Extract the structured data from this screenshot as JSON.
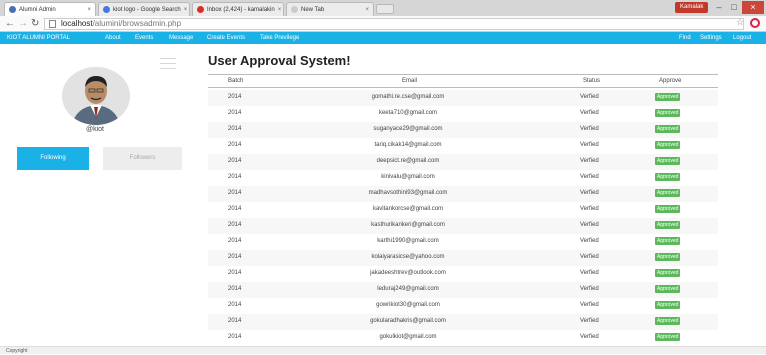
{
  "browser": {
    "tabs": [
      {
        "title": "Alumni Admin",
        "fav": "#4a6fb5"
      },
      {
        "title": "kiot logo - Google Search",
        "fav": "#3d7be0"
      },
      {
        "title": "Inbox (2,424) - kamalakin",
        "fav": "#d93025"
      },
      {
        "title": "New Tab",
        "fav": "#cccccc"
      }
    ],
    "user_badge": "Kamalak",
    "url_host": "localhost",
    "url_path": "/alumini/browsadmin.php"
  },
  "nav": {
    "brand": "KIOT ALUMNI PORTAL",
    "links": [
      "About",
      "Events",
      "Message",
      "Create Events",
      "Take Previlege"
    ],
    "right": [
      "Find",
      "Settings",
      "Logout"
    ]
  },
  "sidebar": {
    "username": "@kiot",
    "following_label": "Following",
    "followers_label": "Followers"
  },
  "main": {
    "title": "User Approval System!",
    "headers": {
      "batch": "Batch",
      "email": "Email",
      "status": "Status",
      "approve": "Approve"
    },
    "rows": [
      {
        "batch": "2014",
        "email": "gomathi.re.cse@gmail.com",
        "status": "Verfied",
        "approve": "Approved"
      },
      {
        "batch": "2014",
        "email": "keeta710@gmail.com",
        "status": "Verfied",
        "approve": "Approved"
      },
      {
        "batch": "2014",
        "email": "suganyace29@gmail.com",
        "status": "Verfied",
        "approve": "Approved"
      },
      {
        "batch": "2014",
        "email": "tariq.cikak14@gmail.com",
        "status": "Verfied",
        "approve": "Approved"
      },
      {
        "batch": "2014",
        "email": "deepsict.re@gmail.com",
        "status": "Verfied",
        "approve": "Approved"
      },
      {
        "batch": "2014",
        "email": "kinivalu@gmail.com",
        "status": "Verfied",
        "approve": "Approved"
      },
      {
        "batch": "2014",
        "email": "madhavsothini93@gmail.com",
        "status": "Verfied",
        "approve": "Approved"
      },
      {
        "batch": "2014",
        "email": "kavitankorcse@gmail.com",
        "status": "Verfied",
        "approve": "Approved"
      },
      {
        "batch": "2014",
        "email": "kasthurikankeri@gmail.com",
        "status": "Verfied",
        "approve": "Approved"
      },
      {
        "batch": "2014",
        "email": "karthi1990@gmail.com",
        "status": "Verfied",
        "approve": "Approved"
      },
      {
        "batch": "2014",
        "email": "kolaiyarasicse@yahoo.com",
        "status": "Verfied",
        "approve": "Approved"
      },
      {
        "batch": "2014",
        "email": "jakadeeshtrev@outlook.com",
        "status": "Verfied",
        "approve": "Approved"
      },
      {
        "batch": "2014",
        "email": "leduraj249@gmail.com",
        "status": "Verfied",
        "approve": "Approved"
      },
      {
        "batch": "2014",
        "email": "gowrikiot30@gmail.com",
        "status": "Verfied",
        "approve": "Approved"
      },
      {
        "batch": "2014",
        "email": "gokularadhakris@gmail.com",
        "status": "Verfied",
        "approve": "Approved"
      },
      {
        "batch": "2014",
        "email": "gokulkiot@gmail.com",
        "status": "Verfied",
        "approve": "Approved"
      }
    ]
  },
  "footer": {
    "text": "Copyright"
  }
}
